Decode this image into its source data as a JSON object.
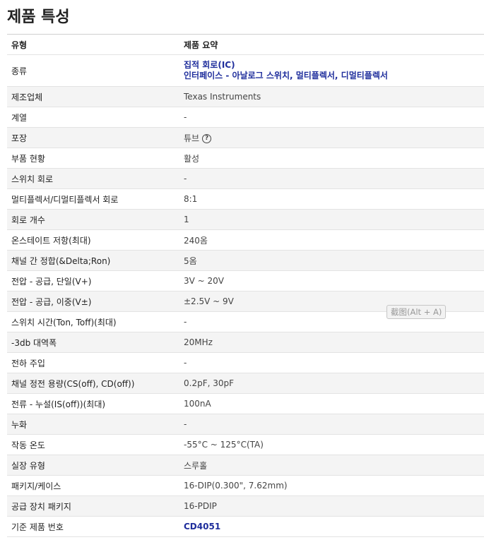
{
  "page_title": "제품 특성",
  "header": {
    "col1": "유형",
    "col2": "제품 요약"
  },
  "rows": [
    {
      "label": "종류",
      "value_line1": "집적 회로(IC)",
      "value_line2": "인터페이스 - 아날로그 스위치, 멀티플렉서, 디멀티플렉서"
    },
    {
      "label": "제조업체",
      "value": "Texas Instruments"
    },
    {
      "label": "계열",
      "value": "-"
    },
    {
      "label": "포장",
      "value": "튜브",
      "help_icon": "question-circle"
    },
    {
      "label": "부품 현황",
      "value": "활성"
    },
    {
      "label": "스위치 회로",
      "value": "-"
    },
    {
      "label": "멀티플렉서/디멀티플렉서 회로",
      "value": "8:1"
    },
    {
      "label": "회로 개수",
      "value": "1"
    },
    {
      "label": "온스테이트 저항(최대)",
      "value": "240옴"
    },
    {
      "label": "채널 간 정합(&Delta;Ron)",
      "value": "5옴"
    },
    {
      "label": "전압 - 공급, 단일(V+)",
      "value": "3V ~ 20V"
    },
    {
      "label": "전압 - 공급, 이중(V±)",
      "value": "±2.5V ~ 9V"
    },
    {
      "label": "스위치 시간(Ton, Toff)(최대)",
      "value": "-"
    },
    {
      "label": "-3db 대역폭",
      "value": "20MHz"
    },
    {
      "label": "전하 주입",
      "value": "-"
    },
    {
      "label": "채널 정전 용량(CS(off), CD(off))",
      "value": "0.2pF, 30pF"
    },
    {
      "label": "전류 - 누설(IS(off))(최대)",
      "value": "100nA"
    },
    {
      "label": "누화",
      "value": "-"
    },
    {
      "label": "작동 온도",
      "value": "-55°C ~ 125°C(TA)"
    },
    {
      "label": "실장 유형",
      "value": "스루홀"
    },
    {
      "label": "패키지/케이스",
      "value": "16-DIP(0.300\", 7.62mm)"
    },
    {
      "label": "공급 장치 패키지",
      "value": "16-PDIP"
    },
    {
      "label": "기준 제품 번호",
      "value": "CD4051"
    }
  ],
  "tooltip": "截图(Alt + A)",
  "colors": {
    "link": "#1f2e9c",
    "alt_row": "#f4f4f4"
  }
}
